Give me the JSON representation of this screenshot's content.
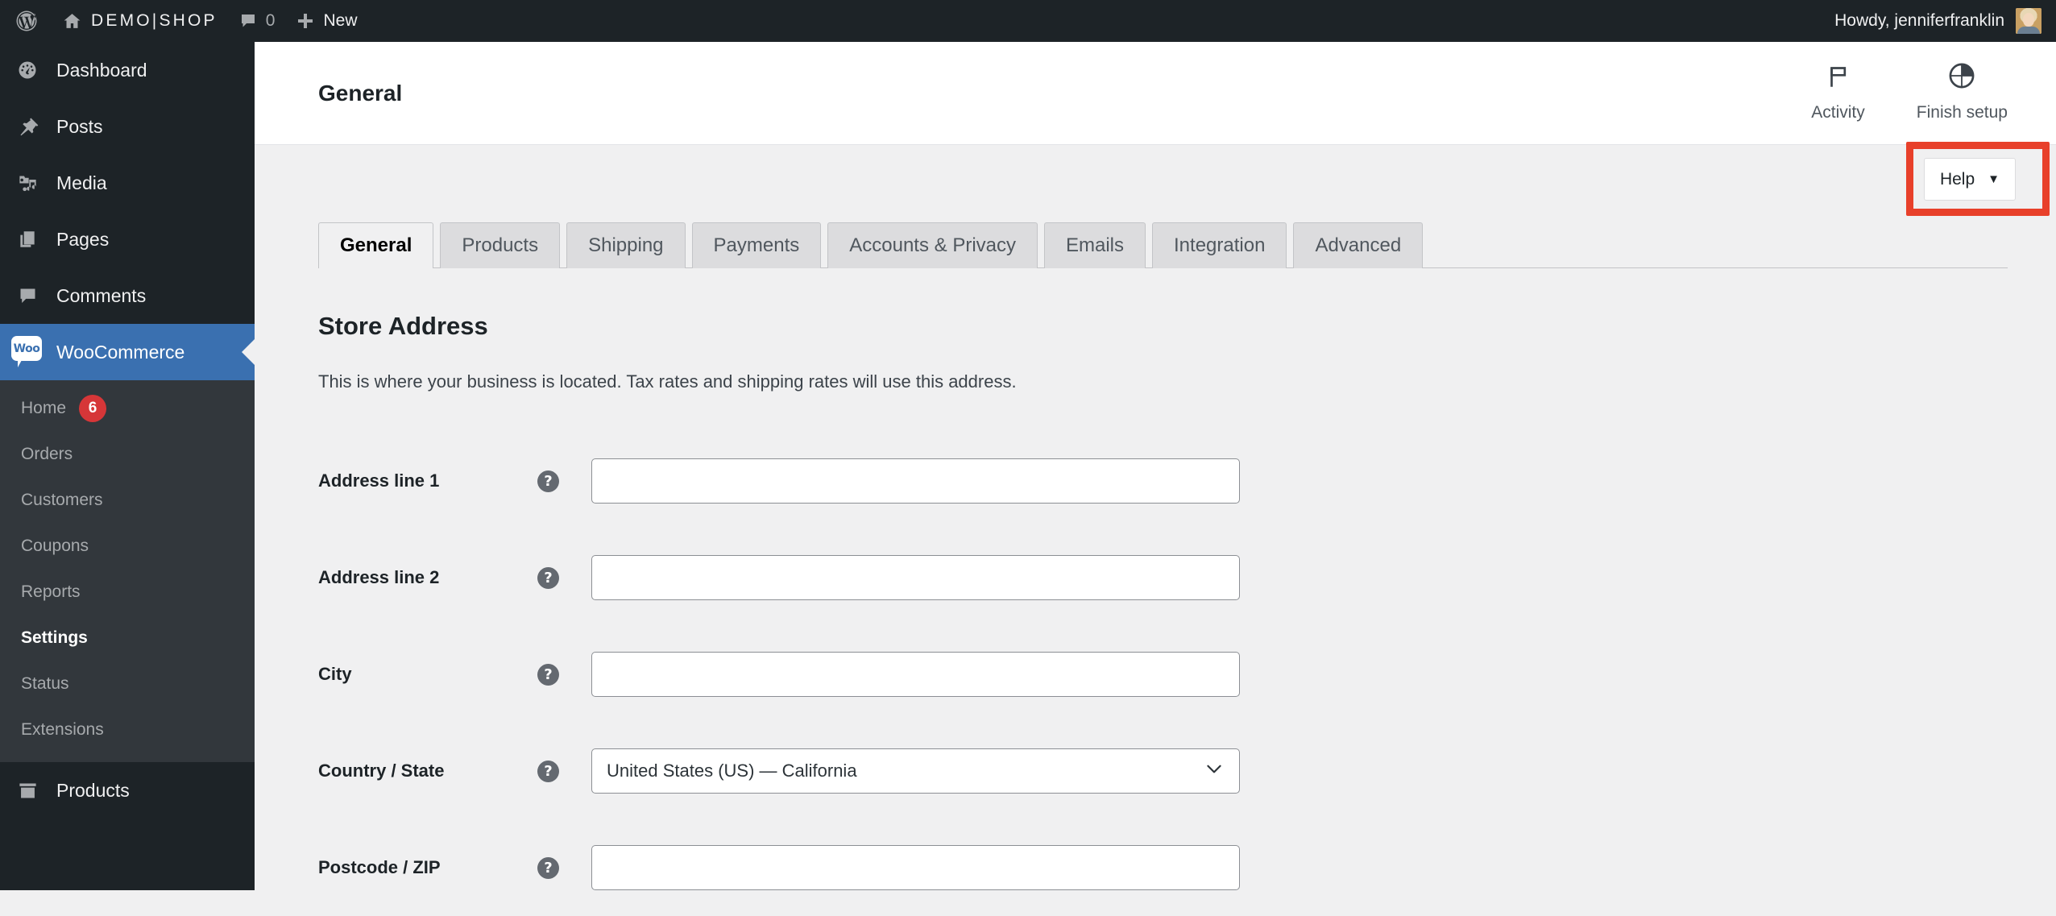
{
  "adminbar": {
    "wp_logo_icon": "wordpress-logo-icon",
    "home_icon": "home-icon",
    "site_name": "DEMO|SHOP",
    "comments_icon": "comment-bubble-icon",
    "comments_count": "0",
    "new_icon": "plus-icon",
    "new_label": "New",
    "account_greeting": "Howdy, jenniferfranklin",
    "avatar_icon": "avatar"
  },
  "sidebar": {
    "items": [
      {
        "label": "Dashboard",
        "icon": "dashboard-gauge-icon",
        "current": false
      },
      {
        "label": "Posts",
        "icon": "pin-icon",
        "current": false
      },
      {
        "label": "Media",
        "icon": "media-camera-music-icon",
        "current": false
      },
      {
        "label": "Pages",
        "icon": "pages-icon",
        "current": false
      },
      {
        "label": "Comments",
        "icon": "comment-bubble-icon",
        "current": false
      },
      {
        "label": "WooCommerce",
        "icon": "woocommerce-logo-icon",
        "current": true
      },
      {
        "label": "Products",
        "icon": "products-box-icon",
        "current": false
      }
    ],
    "woo_icon_text": "Woo",
    "submenu": [
      {
        "label": "Home",
        "badge": "6",
        "current": false
      },
      {
        "label": "Orders",
        "badge": "",
        "current": false
      },
      {
        "label": "Customers",
        "badge": "",
        "current": false
      },
      {
        "label": "Coupons",
        "badge": "",
        "current": false
      },
      {
        "label": "Reports",
        "badge": "",
        "current": false
      },
      {
        "label": "Settings",
        "badge": "",
        "current": true
      },
      {
        "label": "Status",
        "badge": "",
        "current": false
      },
      {
        "label": "Extensions",
        "badge": "",
        "current": false
      }
    ]
  },
  "header": {
    "title": "General",
    "activity_label": "Activity",
    "activity_icon": "flag-icon",
    "finish_setup_label": "Finish setup",
    "finish_setup_icon": "pie-progress-icon"
  },
  "help": {
    "label": "Help",
    "caret": "▼",
    "annotation_color": "#e8402a"
  },
  "tabs": [
    {
      "label": "General",
      "active": true
    },
    {
      "label": "Products",
      "active": false
    },
    {
      "label": "Shipping",
      "active": false
    },
    {
      "label": "Payments",
      "active": false
    },
    {
      "label": "Accounts & Privacy",
      "active": false
    },
    {
      "label": "Emails",
      "active": false
    },
    {
      "label": "Integration",
      "active": false
    },
    {
      "label": "Advanced",
      "active": false
    }
  ],
  "section": {
    "title": "Store Address",
    "description": "This is where your business is located. Tax rates and shipping rates will use this address."
  },
  "form": {
    "help_glyph": "?",
    "fields": [
      {
        "label": "Address line 1",
        "type": "text",
        "value": "",
        "placeholder": ""
      },
      {
        "label": "Address line 2",
        "type": "text",
        "value": "",
        "placeholder": ""
      },
      {
        "label": "City",
        "type": "text",
        "value": "",
        "placeholder": ""
      },
      {
        "label": "Country / State",
        "type": "select",
        "value": "United States (US) — California",
        "placeholder": ""
      },
      {
        "label": "Postcode / ZIP",
        "type": "text",
        "value": "",
        "placeholder": ""
      }
    ]
  },
  "colors": {
    "admin_dark": "#1d2327",
    "submenu_dark": "#32373c",
    "accent_blue": "#3a70b0",
    "badge_red": "#d63638",
    "annotation_red": "#e8402a",
    "page_bg": "#f0f0f1"
  }
}
